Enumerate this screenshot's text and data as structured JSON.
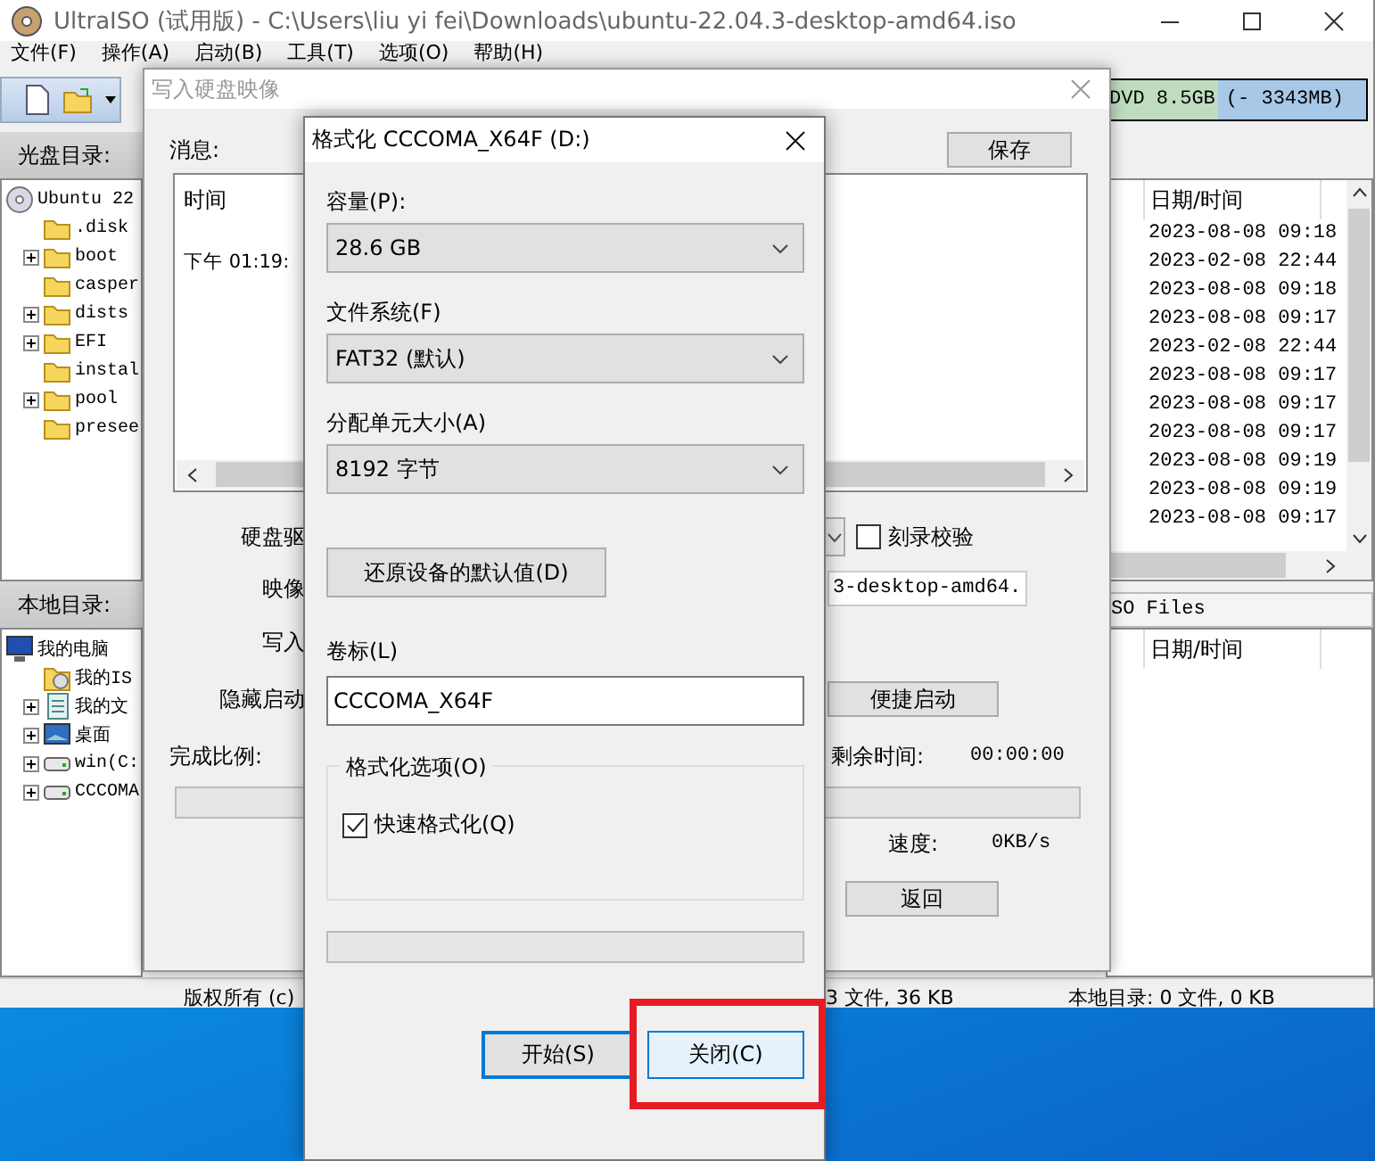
{
  "window": {
    "title": "UltraISO (试用版) - C:\\Users\\liu yi fei\\Downloads\\ubuntu-22.04.3-desktop-amd64.iso"
  },
  "menu": [
    "文件(F)",
    "操作(A)",
    "启动(B)",
    "工具(T)",
    "选项(O)",
    "帮助(H)"
  ],
  "capacity": {
    "media": "DVD 8.5GB",
    "remaining": "(- 3343MB)"
  },
  "cd_dir": {
    "label": "光盘目录:"
  },
  "cd_tree": [
    {
      "name": "Ubuntu 22",
      "kind": "disc",
      "expander": false,
      "children": [
        {
          "name": ".disk",
          "kind": "folder",
          "expander": false
        },
        {
          "name": "boot",
          "kind": "folder",
          "expander": true
        },
        {
          "name": "casper",
          "kind": "folder",
          "expander": false
        },
        {
          "name": "dists",
          "kind": "folder",
          "expander": true
        },
        {
          "name": "EFI",
          "kind": "folder",
          "expander": true
        },
        {
          "name": "instal",
          "kind": "folder",
          "expander": false
        },
        {
          "name": "pool",
          "kind": "folder",
          "expander": true
        },
        {
          "name": "presee",
          "kind": "folder",
          "expander": false
        }
      ]
    }
  ],
  "cd_files": {
    "column": "日期/时间",
    "rows": [
      "2023-08-08 09:18",
      "2023-02-08 22:44",
      "2023-08-08 09:18",
      "2023-08-08 09:17",
      "2023-02-08 22:44",
      "2023-08-08 09:17",
      "2023-08-08 09:17",
      "2023-08-08 09:17",
      "2023-08-08 09:19",
      "2023-08-08 09:19",
      "2023-08-08 09:17"
    ]
  },
  "local_dir": {
    "label": "本地目录:",
    "path": "SO Files"
  },
  "local_tree": [
    {
      "name": "我的电脑",
      "kind": "computer",
      "expander": false,
      "children": [
        {
          "name": "我的IS",
          "kind": "isofolder",
          "expander": false
        },
        {
          "name": "我的文",
          "kind": "docs",
          "expander": true
        },
        {
          "name": "桌面",
          "kind": "desktop",
          "expander": true
        },
        {
          "name": "win(C:",
          "kind": "drive",
          "expander": true
        },
        {
          "name": "CCCOMA",
          "kind": "drive",
          "expander": true
        }
      ]
    }
  ],
  "local_files": {
    "column": "日期/时间"
  },
  "status_bar": [
    "版权所有 (c)",
    "3 文件, 36 KB",
    "本地目录: 0 文件, 0 KB"
  ],
  "write_dialog": {
    "title": "写入硬盘映像",
    "message_label": "消息:",
    "save_button": "保存",
    "log": {
      "column": "时间",
      "rows": [
        "下午 01:19:"
      ]
    },
    "drive_label": "硬盘驱",
    "verify": {
      "label": "刻录校验",
      "checked": false
    },
    "image_label": "映像",
    "image_value": "3-desktop-amd64.",
    "write_label": "写入",
    "hide_label": "隐藏启动",
    "quick_boot_button": "便捷启动",
    "progress_label": "完成比例:",
    "remaining_label": "剩余时间:",
    "remaining_value": "00:00:00",
    "progress": {
      "level": 0
    },
    "speed_label": "速度:",
    "speed_value": "0KB/s",
    "back_button": "返回"
  },
  "format_dialog": {
    "title": "格式化 CCCOMA_X64F (D:)",
    "selects": [
      {
        "label": "容量(P):",
        "value": "28.6 GB"
      },
      {
        "label": "文件系统(F)",
        "value": "FAT32 (默认)"
      },
      {
        "label": "分配单元大小(A)",
        "value": "8192 字节"
      }
    ],
    "restore_button": "还原设备的默认值(D)",
    "volume": {
      "label": "卷标(L)",
      "value": "CCCOMA_X64F"
    },
    "options": {
      "title": "格式化选项(O)",
      "items": [
        {
          "label": "快速格式化(Q)",
          "checked": true
        }
      ]
    },
    "progress": {
      "level": 0
    },
    "buttons": [
      {
        "label": "开始(S)",
        "default": true,
        "hovered": false,
        "highlighted": false
      },
      {
        "label": "关闭(C)",
        "default": false,
        "hovered": true,
        "highlighted": true
      }
    ]
  }
}
